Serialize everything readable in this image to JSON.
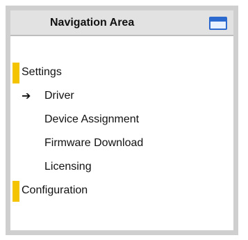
{
  "header": {
    "title": "Navigation Area",
    "icon": "window-icon"
  },
  "nav": {
    "items": [
      {
        "label": "Settings",
        "level": 0,
        "marker": true
      },
      {
        "label": "Driver",
        "level": 1,
        "current": true,
        "indicator": "arrow-right-icon"
      },
      {
        "label": "Device Assignment",
        "level": 1
      },
      {
        "label": "Firmware Download",
        "level": 1
      },
      {
        "label": "Licensing",
        "level": 1
      },
      {
        "label": "Configuration",
        "level": 0,
        "marker": true
      }
    ]
  },
  "colors": {
    "header_bg": "#e2e2e2",
    "panel_border": "#cfcfcf",
    "marker": "#f5c400",
    "icon_blue": "#2d6ad0"
  }
}
